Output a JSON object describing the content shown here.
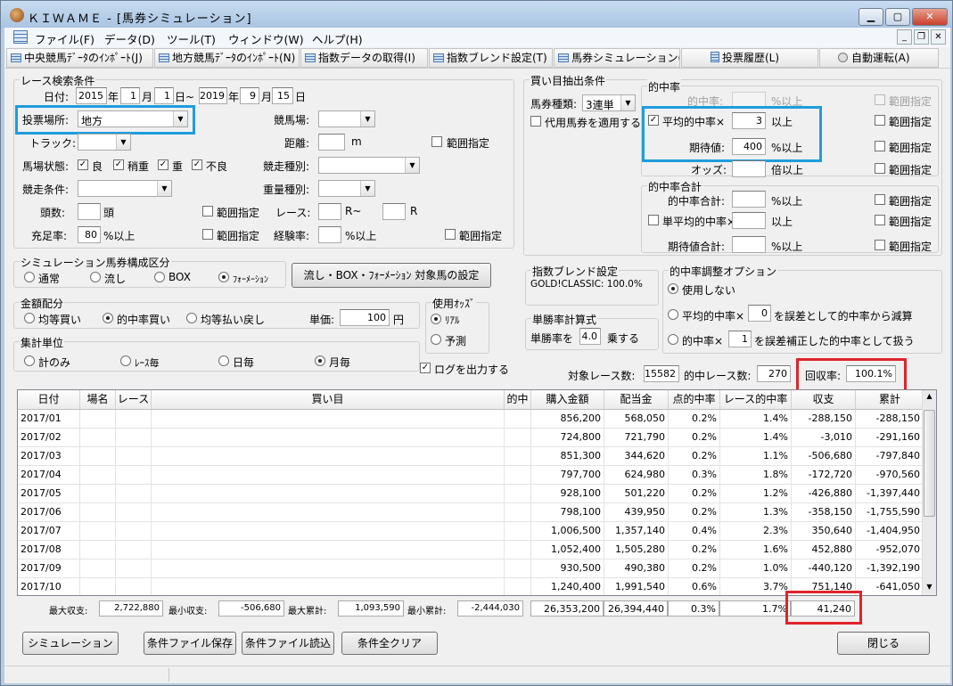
{
  "window": {
    "title": "ＫＩＷＡＭＥ - [馬券シミュレーション]"
  },
  "menu": [
    "ファイル(F)",
    "データ(D)",
    "ツール(T)",
    "ウィンドウ(W)",
    "ヘルプ(H)"
  ],
  "toolbar": [
    "中央競馬ﾃﾞｰﾀのｲﾝﾎﾟｰﾄ(J)",
    "地方競馬ﾃﾞｰﾀのｲﾝﾎﾟｰﾄ(N)",
    "指数データの取得(I)",
    "指数ブレンド設定(T)",
    "馬券シミュレーション(B)",
    "投票履歴(L)",
    "自動運転(A)"
  ],
  "race": {
    "group": "レース検索条件",
    "date_label": "日付:",
    "from_year": "2015",
    "year_u": "年",
    "from_month": "1",
    "month_u": "月",
    "from_day": "1",
    "day_tilde": "日~",
    "to_year": "2019",
    "to_month": "9",
    "to_day": "15",
    "day_u": "日",
    "venue_label": "投票場所:",
    "venue": "地方",
    "keiba_label": "競馬場:",
    "track_label": "トラック:",
    "distance_label": "距離:",
    "m": "m",
    "range": "範囲指定",
    "cond_label": "馬場状態:",
    "cond": [
      "良",
      "稍重",
      "重",
      "不良"
    ],
    "kind_label": "競走種別:",
    "race_cond_label": "競走条件:",
    "weight_label": "重量種別:",
    "heads_label": "頭数:",
    "heads_u": "頭",
    "race_label": "レース:",
    "r_tilde": "R~",
    "r": "R",
    "fill_label": "充足率:",
    "fill": "80",
    "pct_over": "%以上",
    "exp_label": "経験率:",
    "exp_u": "%以上"
  },
  "buy": {
    "group": "買い目抽出条件",
    "ticket_label": "馬券種類:",
    "ticket": "3連単",
    "substitute": "代用馬券を適用する",
    "hit_group": "的中率",
    "hit_rate_label": "的中率:",
    "pct_over": "%以上",
    "avg_hit_label": "平均的中率×",
    "avg_hit": "3",
    "over": "以上",
    "expect_label": "期待値:",
    "expect": "400",
    "odds_label": "オッズ:",
    "odds_u": "倍以上",
    "range": "範囲指定",
    "sum_group": "的中率合計",
    "sum_hit_label": "的中率合計:",
    "single_avg_label": "単平均的中率×",
    "expect_sum_label": "期待値合計:"
  },
  "sim": {
    "group": "シミュレーション馬券構成区分",
    "opts": [
      "通常",
      "流し",
      "BOX",
      "ﾌｫｰﾒｰｼｮﾝ"
    ],
    "set_btn": "流し・BOX・ﾌｫｰﾒｰｼｮﾝ 対象馬の設定",
    "money_group": "金額配分",
    "money": [
      "均等買い",
      "的中率買い",
      "均等払い戻し"
    ],
    "unit_label": "単価:",
    "unit": "100",
    "yen": "円",
    "agg_group": "集計単位",
    "agg": [
      "計のみ",
      "ﾚｰｽ毎",
      "日毎",
      "月毎"
    ],
    "odds_group": "使用ｵｯｽﾞ",
    "odds": [
      "ﾘｱﾙ",
      "予測"
    ],
    "log": "ログを出力する"
  },
  "blend": {
    "group": "指数ブレンド設定",
    "text": "GOLD!CLASSIC: 100.0%"
  },
  "winrate": {
    "group": "単勝率計算式",
    "label": "単勝率を",
    "value": "4.0",
    "suffix": "乗する"
  },
  "adjust": {
    "group": "的中率調整オプション",
    "opt1": "使用しない",
    "opt2a": "平均的中率×",
    "opt2b": "を誤差として的中率から減算",
    "v2": "0",
    "opt3a": "的中率×",
    "opt3b": "を誤差補正した的中率として扱う",
    "v3": "1"
  },
  "summary": {
    "races_label": "対象レース数:",
    "races": "15582",
    "hits_label": "的中レース数:",
    "hits": "270",
    "return_label": "回収率:",
    "return": "100.1%"
  },
  "table": {
    "headers": [
      "日付",
      "場名",
      "レース",
      "買い目",
      "的中",
      "購入金額",
      "配当金",
      "点的中率",
      "レース的中率",
      "収支",
      "累計"
    ],
    "rows": [
      [
        "2017/01",
        "",
        "",
        "",
        "",
        "856,200",
        "568,050",
        "0.2%",
        "1.4%",
        "-288,150",
        "-288,150"
      ],
      [
        "2017/02",
        "",
        "",
        "",
        "",
        "724,800",
        "721,790",
        "0.2%",
        "1.4%",
        "-3,010",
        "-291,160"
      ],
      [
        "2017/03",
        "",
        "",
        "",
        "",
        "851,300",
        "344,620",
        "0.2%",
        "1.1%",
        "-506,680",
        "-797,840"
      ],
      [
        "2017/04",
        "",
        "",
        "",
        "",
        "797,700",
        "624,980",
        "0.3%",
        "1.8%",
        "-172,720",
        "-970,560"
      ],
      [
        "2017/05",
        "",
        "",
        "",
        "",
        "928,100",
        "501,220",
        "0.2%",
        "1.2%",
        "-426,880",
        "-1,397,440"
      ],
      [
        "2017/06",
        "",
        "",
        "",
        "",
        "798,100",
        "439,950",
        "0.2%",
        "1.3%",
        "-358,150",
        "-1,755,590"
      ],
      [
        "2017/07",
        "",
        "",
        "",
        "",
        "1,006,500",
        "1,357,140",
        "0.4%",
        "2.3%",
        "350,640",
        "-1,404,950"
      ],
      [
        "2017/08",
        "",
        "",
        "",
        "",
        "1,052,400",
        "1,505,280",
        "0.2%",
        "1.6%",
        "452,880",
        "-952,070"
      ],
      [
        "2017/09",
        "",
        "",
        "",
        "",
        "930,500",
        "490,380",
        "0.2%",
        "1.0%",
        "-440,120",
        "-1,392,190"
      ],
      [
        "2017/10",
        "",
        "",
        "",
        "",
        "1,240,400",
        "1,991,540",
        "0.6%",
        "3.7%",
        "751,140",
        "-641,050"
      ]
    ]
  },
  "footer": {
    "max_income_label": "最大収支:",
    "max_income": "2,722,880",
    "min_income_label": "最小収支:",
    "min_income": "-506,680",
    "max_cum_label": "最大累計:",
    "max_cum": "1,093,590",
    "min_cum_label": "最小累計:",
    "min_cum": "-2,444,030",
    "total_buy": "26,353,200",
    "total_pay": "26,394,440",
    "total_hit": "0.3%",
    "total_race_hit": "1.7%",
    "total_income": "41,240"
  },
  "buttons": {
    "simulate": "シミュレーション",
    "save": "条件ファイル保存",
    "load": "条件ファイル読込",
    "clear": "条件全クリア",
    "close": "閉じる"
  }
}
